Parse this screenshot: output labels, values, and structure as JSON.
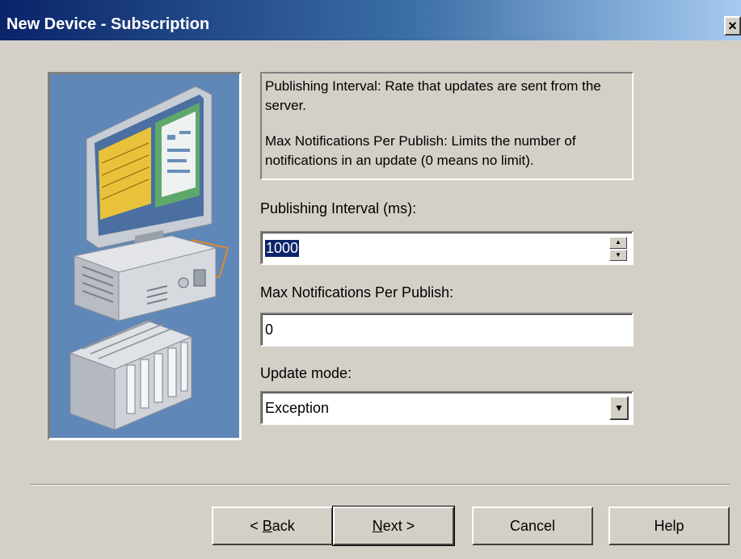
{
  "window": {
    "title": "New Device - Subscription",
    "close_label": "×"
  },
  "description": {
    "line1": "Publishing Interval: Rate that updates are sent from the server.",
    "line2": "Max Notifications Per Publish: Limits the number of notifications in an update (0 means no limit)."
  },
  "publishing_interval": {
    "label": "Publishing Interval (ms):",
    "value": "1000",
    "spin_up": "▲",
    "spin_down": "▼"
  },
  "max_notifications": {
    "label": "Max Notifications Per Publish:",
    "value": "0"
  },
  "update_mode": {
    "label": "Update mode:",
    "value": "Exception",
    "arrow": "▼"
  },
  "buttons": {
    "back_prefix": "< ",
    "back_mnemonic": "B",
    "back_rest": "ack",
    "next_mnemonic": "N",
    "next_rest": "ext >",
    "cancel": "Cancel",
    "help": "Help"
  },
  "icons": {
    "illustration": "computer-and-plc-illustration",
    "close": "close-icon",
    "spin": "spinner-arrows-icon",
    "dropdown": "chevron-down-icon"
  },
  "colors": {
    "titlebar_start": "#0a246a",
    "titlebar_end": "#a6caf0",
    "dialog_bg": "#d4d0c8",
    "illustration_bg": "#5f87b7",
    "selection": "#0a246a"
  }
}
